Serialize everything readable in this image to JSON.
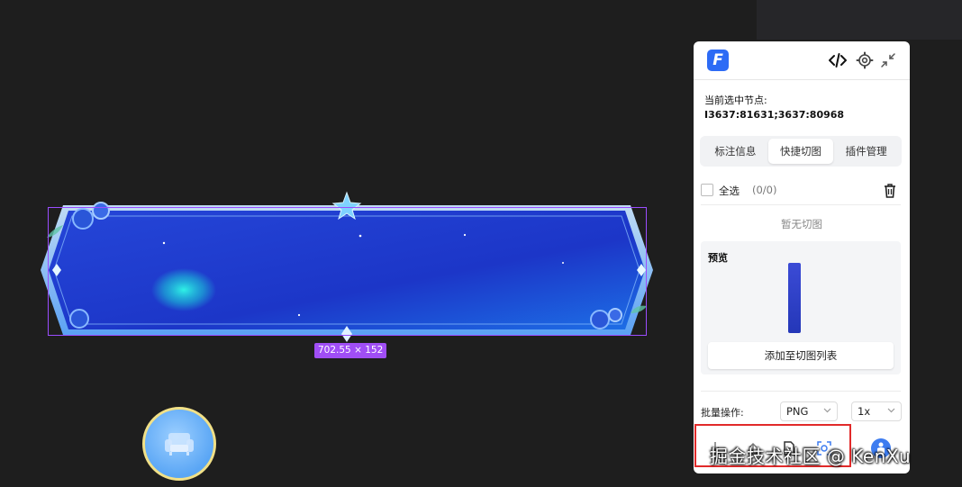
{
  "canvas": {
    "selection_size_label": "702.55 × 152"
  },
  "panel": {
    "logo_letter": "F",
    "header_icons": [
      "code-icon",
      "gear-icon",
      "collapse-icon"
    ],
    "node_label": "当前选中节点:",
    "node_id": "I3637:81631;3637:80968",
    "tabs": [
      {
        "label": "标注信息",
        "active": false
      },
      {
        "label": "快捷切图",
        "active": true
      },
      {
        "label": "插件管理",
        "active": false
      }
    ],
    "select_all_label": "全选",
    "select_all_count": "(0/0)",
    "empty_text": "暂无切图",
    "preview": {
      "title": "预览",
      "add_button": "添加至切图列表"
    },
    "batch": {
      "label": "批量操作:",
      "format": "PNG",
      "scale": "1x"
    },
    "actions": [
      "download-icon",
      "upload-icon",
      "file-icon",
      "scan-icon"
    ]
  },
  "watermark": "掘金技术社区 @ KenXu",
  "colors": {
    "accent": "#2d6bf5",
    "selection": "#9b4dff",
    "highlight": "#e12a2a"
  }
}
